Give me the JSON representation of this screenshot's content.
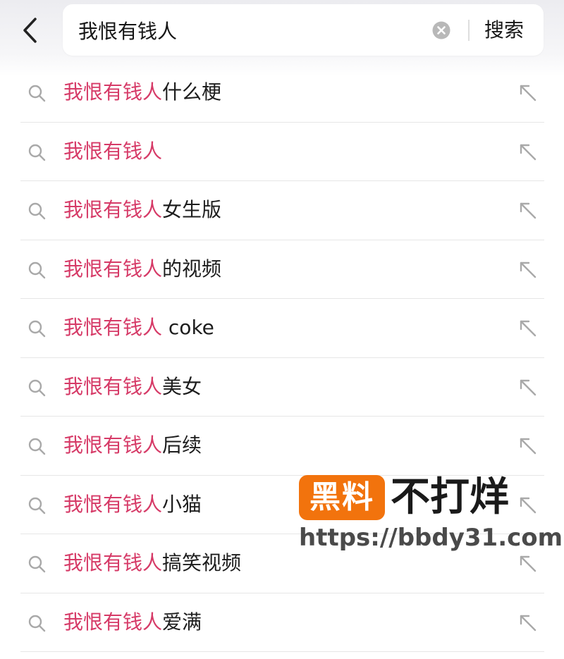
{
  "search": {
    "value": "我恨有钱人",
    "button_label": "搜索"
  },
  "suggestions": [
    {
      "highlight": "我恨有钱人",
      "suffix": "什么梗"
    },
    {
      "highlight": "我恨有钱人",
      "suffix": ""
    },
    {
      "highlight": "我恨有钱人",
      "suffix": "女生版"
    },
    {
      "highlight": "我恨有钱人",
      "suffix": "的视频"
    },
    {
      "highlight": "我恨有钱人",
      "suffix": " coke"
    },
    {
      "highlight": "我恨有钱人",
      "suffix": "美女"
    },
    {
      "highlight": "我恨有钱人",
      "suffix": "后续"
    },
    {
      "highlight": "我恨有钱人",
      "suffix": "小猫"
    },
    {
      "highlight": "我恨有钱人",
      "suffix": "搞笑视频"
    },
    {
      "highlight": "我恨有钱人",
      "suffix": "爱满"
    }
  ],
  "watermark": {
    "badge": "黑料",
    "title": "不打烊",
    "url": "https://bbdy31.com"
  },
  "colors": {
    "highlight": "#d63a67",
    "text": "#1d1d1d",
    "icon": "#a9a9a9",
    "watermark_badge": "#f2730d"
  },
  "icons": {
    "back": "chevron-left-icon",
    "clear": "clear-circle-icon",
    "suggestion": "search-icon",
    "fill": "arrow-up-left-icon"
  }
}
